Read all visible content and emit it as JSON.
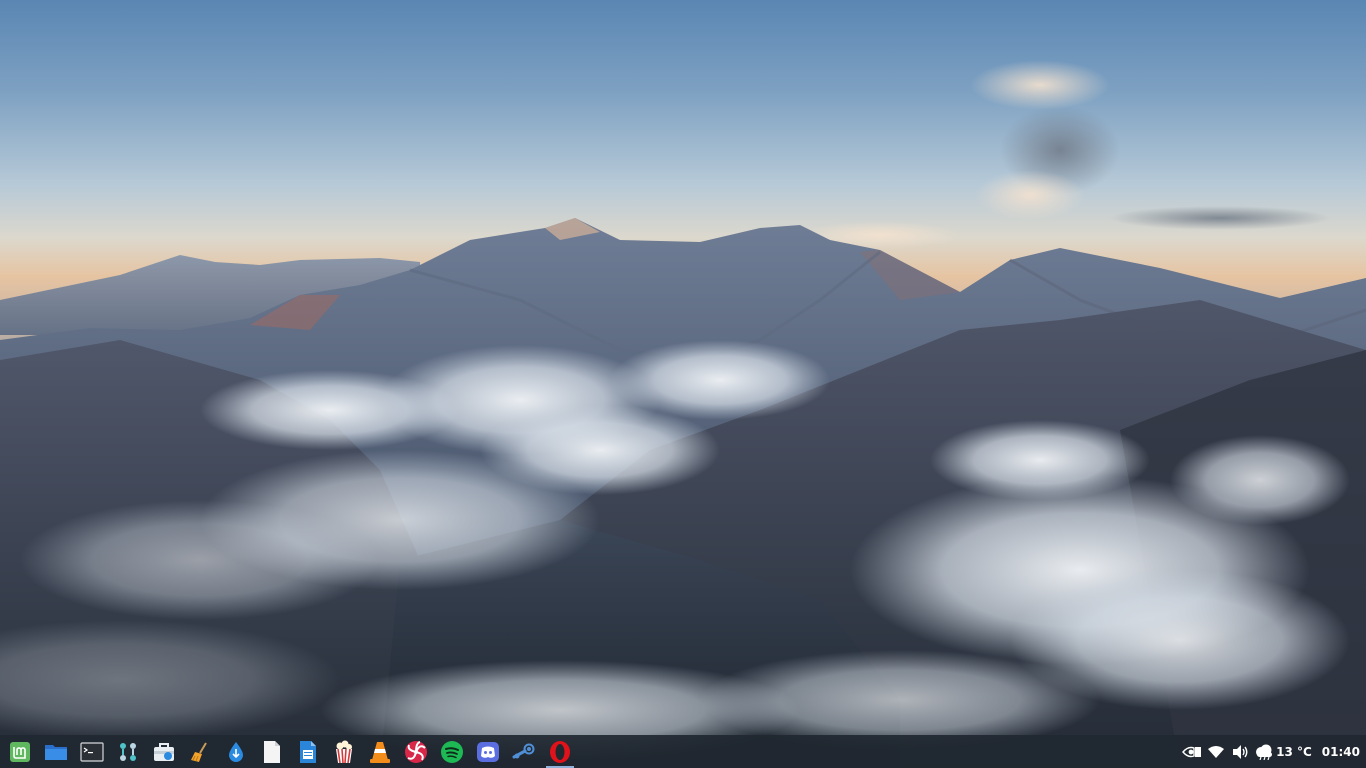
{
  "wallpaper": {
    "description_name": "mountain-sunrise-clouds",
    "sky_colors": [
      "#5b87b2",
      "#a9c2d6",
      "#dfd7c8",
      "#e8b88f"
    ],
    "mountain_color": "#3f4f63",
    "cloud_color": "#e6edf3"
  },
  "panel": {
    "background": "#202830",
    "launchers": [
      {
        "id": "menu",
        "icon": "linux-mint-menu-icon",
        "color": "#5fb85f"
      },
      {
        "id": "files",
        "icon": "folder-icon",
        "color": "#3a86e0"
      },
      {
        "id": "terminal",
        "icon": "terminal-icon",
        "color": "#2b2b2b"
      },
      {
        "id": "settings",
        "icon": "settings-nodes-icon",
        "color": "#4fc3c9"
      },
      {
        "id": "store",
        "icon": "software-store-icon",
        "color": "#e9eef3"
      },
      {
        "id": "cleaner",
        "icon": "broom-cleaner-icon",
        "color": "#f2a32b"
      },
      {
        "id": "downloader",
        "icon": "download-drop-icon",
        "color": "#2a8be0"
      },
      {
        "id": "document",
        "icon": "document-icon",
        "color": "#f4f4f4"
      },
      {
        "id": "writer",
        "icon": "office-document-icon",
        "color": "#2b86d9"
      },
      {
        "id": "popcorn",
        "icon": "popcorn-icon",
        "color": "#d33b3b"
      },
      {
        "id": "vlc",
        "icon": "vlc-cone-icon",
        "color": "#f28c1b"
      },
      {
        "id": "lollypop",
        "icon": "lollypop-music-icon",
        "color": "#d9274a"
      },
      {
        "id": "spotify",
        "icon": "spotify-icon",
        "color": "#1db954"
      },
      {
        "id": "discord",
        "icon": "discord-icon",
        "color": "#5b6ee1"
      },
      {
        "id": "steam",
        "icon": "steam-icon",
        "color": "#4f8fd6"
      },
      {
        "id": "opera",
        "icon": "opera-icon",
        "color": "#e0121a",
        "active": true
      }
    ],
    "tray": {
      "nvidia_icon": "nvidia-icon",
      "wifi_icon": "wifi-icon",
      "volume_icon": "volume-icon",
      "weather_icon": "weather-cloud-icon",
      "temperature": "13 °C",
      "clock": "01:40"
    }
  }
}
